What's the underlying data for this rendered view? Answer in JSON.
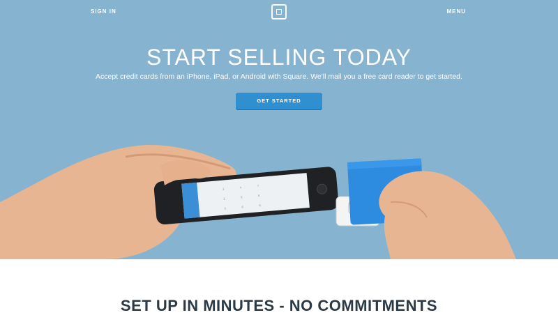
{
  "nav": {
    "sign_in": "SIGN IN",
    "menu": "MENU",
    "logo_icon": "square-logo-icon"
  },
  "hero": {
    "headline": "START SELLING TODAY",
    "subheadline": "Accept credit cards from an iPhone, iPad, or Android with Square. We'll mail you a free card reader to get started.",
    "cta_label": "GET STARTED",
    "background_color": "#85b3d0",
    "cta_color": "#2f8fd0"
  },
  "section": {
    "title": "SET UP IN MINUTES - NO COMMITMENTS"
  }
}
